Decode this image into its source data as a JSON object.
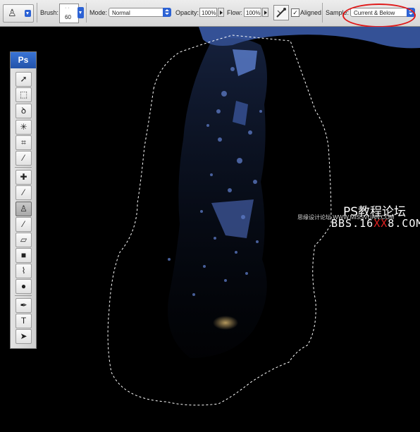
{
  "options_bar": {
    "tool_preset_icon": "clone-stamp-icon",
    "brush_label": "Brush:",
    "brush_size": "60",
    "mode_label": "Mode:",
    "mode_value": "Normal",
    "opacity_label": "Opacity:",
    "opacity_value": "100%",
    "flow_label": "Flow:",
    "flow_value": "100%",
    "airbrush_icon": "airbrush-icon",
    "aligned_label": "Aligned",
    "aligned_checked": true,
    "sample_label": "Sample:",
    "sample_value": "Current & Below",
    "highlight_color": "#e01a1a"
  },
  "toolbox": {
    "logo": "Ps",
    "tools": [
      {
        "name": "move-tool-icon",
        "glyph": "➚"
      },
      {
        "name": "marquee-tool-icon",
        "glyph": "⬚"
      },
      {
        "name": "lasso-tool-icon",
        "glyph": "ꝺ"
      },
      {
        "name": "magic-wand-tool-icon",
        "glyph": "✳"
      },
      {
        "name": "crop-tool-icon",
        "glyph": "⌗"
      },
      {
        "name": "slice-tool-icon",
        "glyph": "⁄"
      },
      {
        "name": "healing-brush-tool-icon",
        "glyph": "✚"
      },
      {
        "name": "brush-tool-icon",
        "glyph": "⁄"
      },
      {
        "name": "clone-stamp-tool-icon",
        "glyph": "♙",
        "active": true
      },
      {
        "name": "history-brush-tool-icon",
        "glyph": "⁄"
      },
      {
        "name": "eraser-tool-icon",
        "glyph": "▱"
      },
      {
        "name": "gradient-tool-icon",
        "glyph": "■"
      },
      {
        "name": "blur-tool-icon",
        "glyph": "⌇"
      },
      {
        "name": "dodge-tool-icon",
        "glyph": "●"
      },
      {
        "name": "pen-tool-icon",
        "glyph": "✒"
      },
      {
        "name": "type-tool-icon",
        "glyph": "T"
      },
      {
        "name": "path-selection-tool-icon",
        "glyph": "➤"
      }
    ]
  },
  "watermark": {
    "title": "PS教程论坛",
    "subtitle": "思缘设计论坛 WWW.MISSVUAN.COM",
    "url_prefix": "BBS.16",
    "url_red": "XX",
    "url_suffix": "8.COM"
  },
  "colors": {
    "canvas_background": "#000000",
    "image_blue": "#3a5aa8",
    "selection_outline": "#ffffff"
  }
}
